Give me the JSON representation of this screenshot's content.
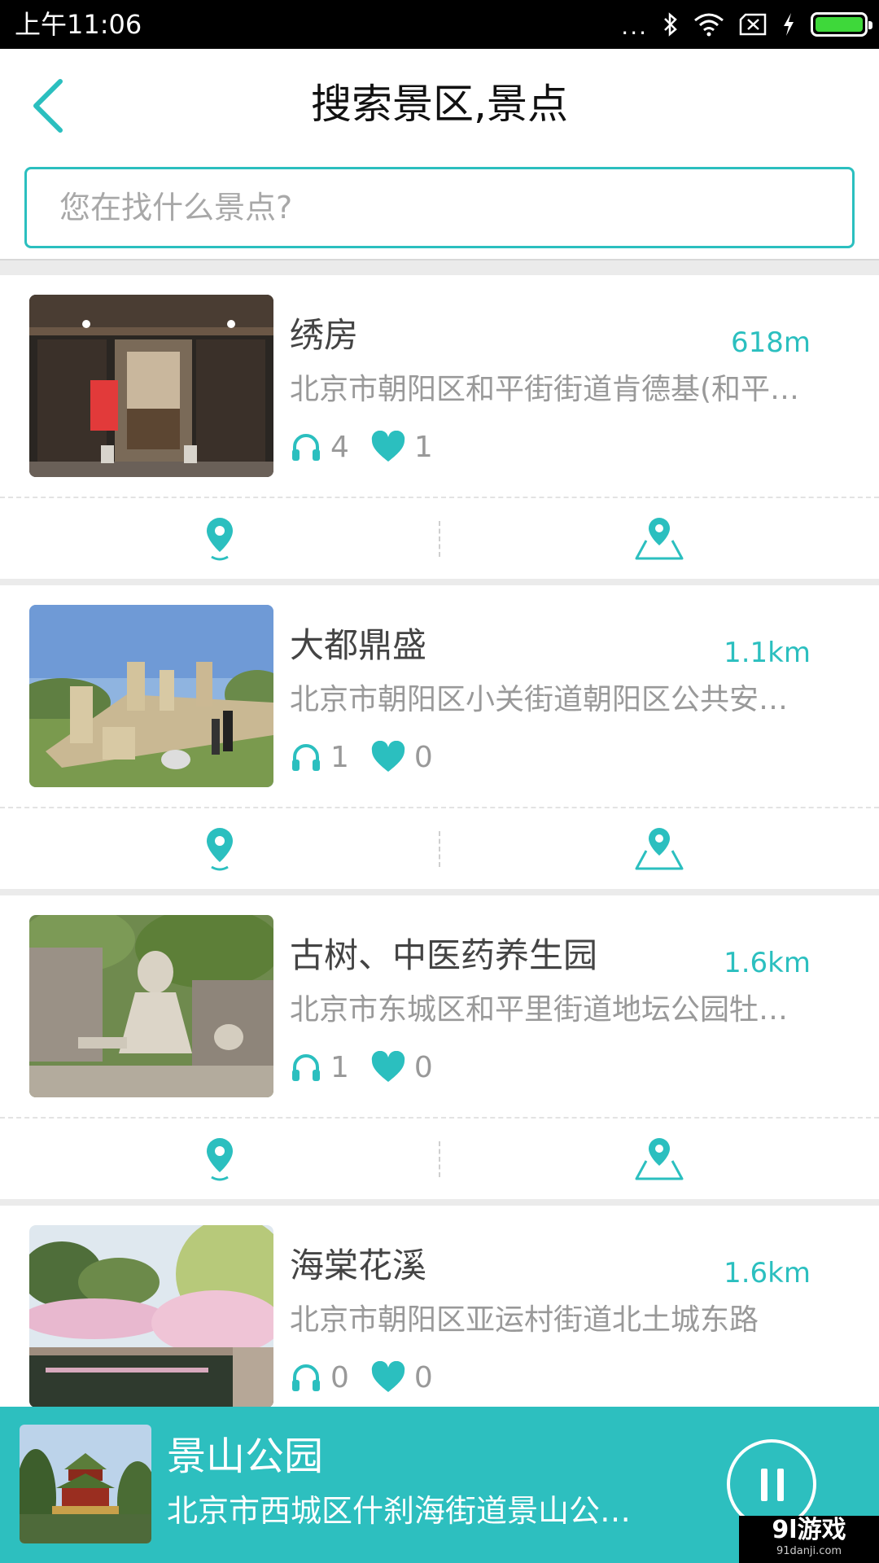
{
  "status_bar": {
    "time": "上午11:06",
    "dots": "..."
  },
  "header": {
    "title": "搜索景区,景点",
    "back_icon": "chevron-left-icon"
  },
  "search": {
    "placeholder": "您在找什么景点?",
    "value": ""
  },
  "colors": {
    "accent": "#2bbfbf",
    "player_bg": "#2dbfbf",
    "text_gray": "#999999"
  },
  "spots": [
    {
      "name": "绣房",
      "distance": "618m",
      "address": "北京市朝阳区和平街街道肯德基(和平…",
      "listens": "4",
      "likes": "1"
    },
    {
      "name": "大都鼎盛",
      "distance": "1.1km",
      "address": "北京市朝阳区小关街道朝阳区公共安…",
      "listens": "1",
      "likes": "0"
    },
    {
      "name": "古树、中医药养生园",
      "distance": "1.6km",
      "address": "北京市东城区和平里街道地坛公园牡…",
      "listens": "1",
      "likes": "0"
    },
    {
      "name": "海棠花溪",
      "distance": "1.6km",
      "address": "北京市朝阳区亚运村街道北土城东路",
      "listens": "0",
      "likes": "0"
    }
  ],
  "player": {
    "name": "景山公园",
    "address": "北京市西城区什刹海街道景山公…",
    "state": "playing"
  },
  "watermark": {
    "main": "9l游戏",
    "sub": "91danji.com"
  }
}
